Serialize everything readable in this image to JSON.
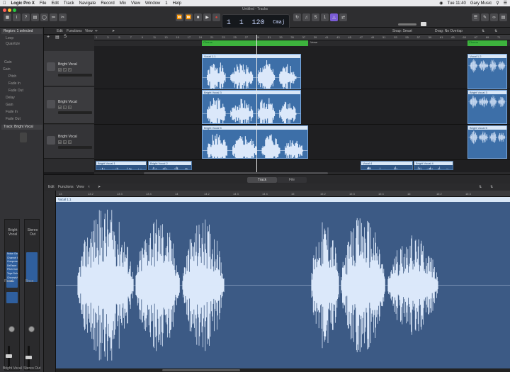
{
  "menubar": {
    "app": "Logic Pro X",
    "items": [
      "File",
      "Edit",
      "Track",
      "Navigate",
      "Record",
      "Mix",
      "View",
      "Window",
      "1",
      "Help"
    ],
    "clock": "Tue 11:40",
    "user": "Gary Music"
  },
  "window": {
    "title": "Untitled - Tracks"
  },
  "lcd": {
    "bar": "1",
    "beat": "1",
    "tempo": "120",
    "key": "Cmaj"
  },
  "inspector": {
    "region_header": "Region: 1 selected",
    "track_header": "Track: Bright Vocal",
    "rows": [
      "Loop",
      "Quantize",
      "Gain",
      "Gain",
      "Pitch",
      "Fade In",
      "Fade Out",
      "Delay",
      "Gain",
      "Fade In",
      "Fade Out"
    ],
    "strip1_name": "Bright Vocal",
    "strip2_name": "Stereo Out",
    "plugins": [
      "Noise Gate",
      "Channel EQ",
      "Compressor",
      "DeEsser",
      "Pitch Corr",
      "Tape Delay",
      "ChromaVerb",
      "Limiter"
    ],
    "bottom_labels": [
      "Bright Vocal",
      "Stereo Out"
    ],
    "read_label": "Read",
    "bnce": "Bnce"
  },
  "tracks_toolbar": {
    "edit": "Edit",
    "functions": "Functions",
    "view": "View",
    "snap": "Snap: Smart",
    "drag": "Drag: No Overlap"
  },
  "ruler_ticks": [
    "1",
    "3",
    "5",
    "7",
    "9",
    "11",
    "13",
    "15",
    "17",
    "19",
    "21",
    "23",
    "25",
    "27",
    "29",
    "31",
    "33",
    "35",
    "37",
    "39",
    "41",
    "43",
    "45",
    "47",
    "49",
    "51",
    "53",
    "55",
    "57",
    "59",
    "61",
    "63",
    "65",
    "67",
    "69",
    "71"
  ],
  "markers": [
    {
      "label": "Chorus",
      "kind": "green"
    },
    {
      "label": "Verse",
      "kind": "text"
    },
    {
      "label": "Chorus",
      "kind": "green"
    }
  ],
  "tracks": [
    {
      "name": "Bright Vocal",
      "num": "1"
    },
    {
      "name": "Bright Vocal",
      "num": "2"
    },
    {
      "name": "Bright Vocal",
      "num": "3"
    }
  ],
  "regions": [
    {
      "title": "Vocal 1.1",
      "lane": 0
    },
    {
      "title": "Vocal 1.2",
      "lane": 0
    },
    {
      "title": "Bright Vocal 3",
      "lane": 1
    },
    {
      "title": "Bright Vocal 3",
      "lane": 1
    },
    {
      "title": "Bright Vocal 5",
      "lane": 2
    },
    {
      "title": "Bright Vocal 5",
      "lane": 2
    },
    {
      "title": "Bright Vocal 1",
      "lane": 3
    },
    {
      "title": "Bright Vocal 2",
      "lane": 3
    },
    {
      "title": "Vocal 4",
      "lane": 3
    },
    {
      "title": "Bright Vocal 4",
      "lane": 3
    }
  ],
  "editor": {
    "tab_track": "Track",
    "tab_file": "File",
    "edit": "Edit",
    "functions": "Functions",
    "view": "View",
    "region_title": "Vocal 1.1",
    "ruler": [
      "13",
      "13 2",
      "13 3",
      "13 4",
      "14",
      "14 2",
      "14 3",
      "14 4",
      "15",
      "15 2",
      "15 3",
      "15 4",
      "16",
      "16 2",
      "16 3"
    ]
  },
  "colors": {
    "marker": "#3db33d",
    "region": "#3d6fa8",
    "wave": "#dbe8fa",
    "accent": "#7a5cd6",
    "record": "#e0463e"
  }
}
